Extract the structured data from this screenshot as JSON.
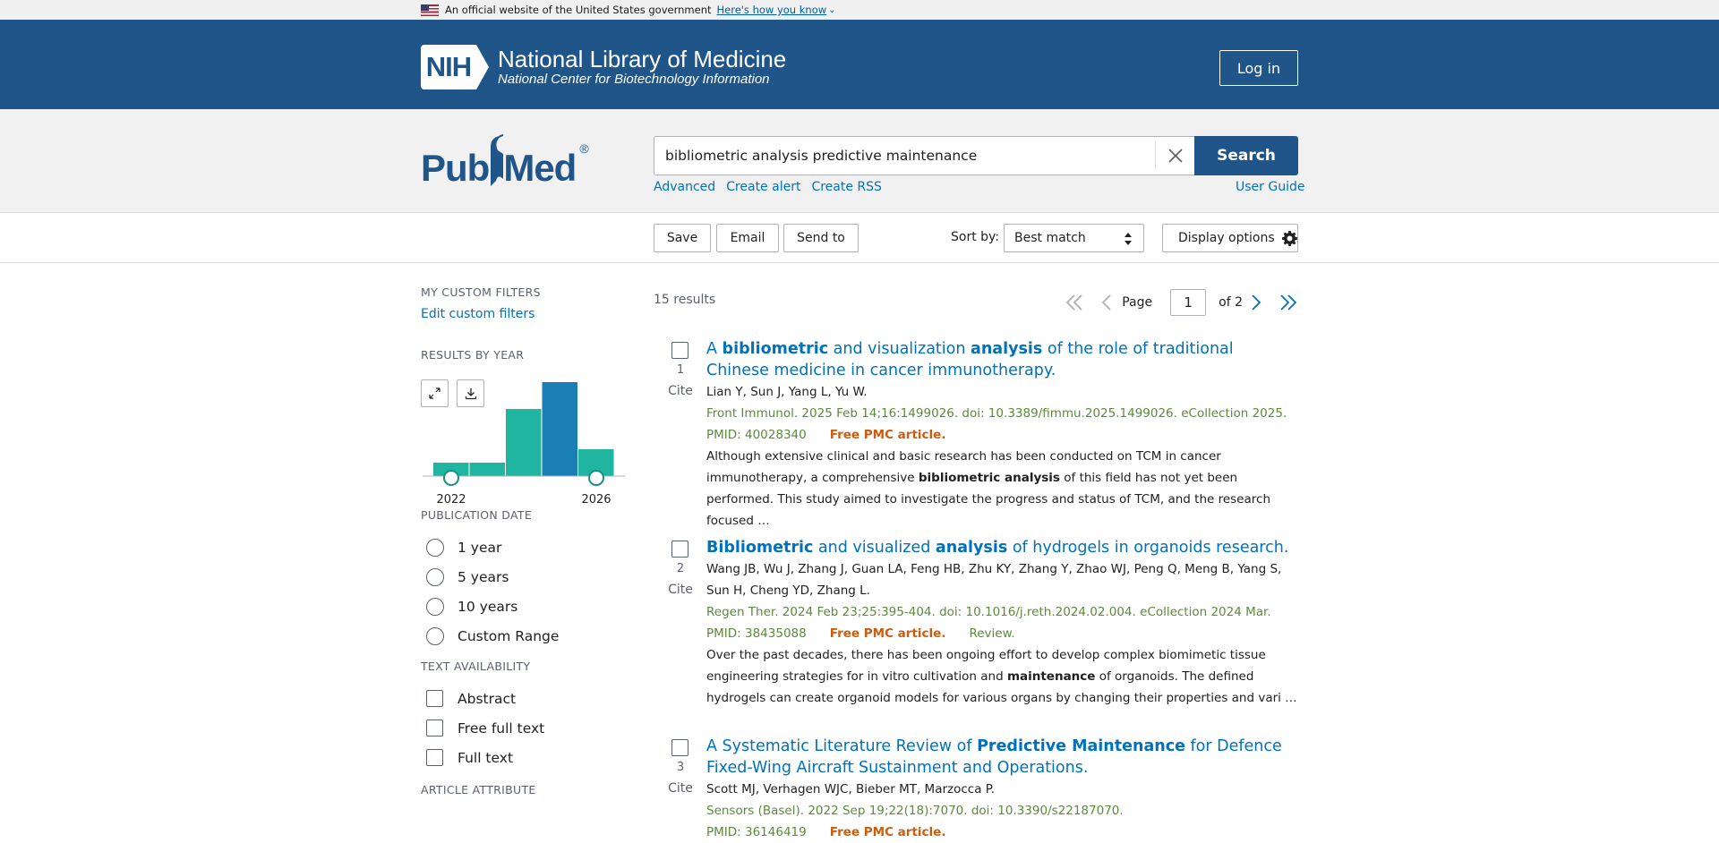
{
  "gov_banner": {
    "text": "An official website of the United States government",
    "link": "Here's how you know"
  },
  "nih": {
    "badge": "NIH",
    "title": "National Library of Medicine",
    "subtitle": "National Center for Biotechnology Information",
    "login": "Log in"
  },
  "pubmed": {
    "logo_pub": "Pub",
    "logo_med": "Med",
    "logo_reg": "®",
    "search_value": "bibliometric analysis predictive maintenance",
    "search_button": "Search",
    "links": [
      "Advanced",
      "Create alert",
      "Create RSS"
    ],
    "user_guide": "User Guide"
  },
  "toolbar": {
    "save": "Save",
    "email": "Email",
    "send_to": "Send to",
    "sort_label": "Sort by:",
    "sort_value": "Best match",
    "display_options": "Display options"
  },
  "sidebar": {
    "custom_filters_heading": "MY CUSTOM FILTERS",
    "edit_custom_filters": "Edit custom filters",
    "results_by_year_heading": "RESULTS BY YEAR",
    "year_start": "2022",
    "year_end": "2026",
    "publication_date_heading": "PUBLICATION DATE",
    "publication_date_options": [
      "1 year",
      "5 years",
      "10 years",
      "Custom Range"
    ],
    "text_availability_heading": "TEXT AVAILABILITY",
    "text_availability_options": [
      "Abstract",
      "Free full text",
      "Full text"
    ],
    "article_attribute_heading": "ARTICLE ATTRIBUTE"
  },
  "chart_data": {
    "type": "bar",
    "categories": [
      "2022",
      "2023",
      "2024",
      "2025",
      "2026"
    ],
    "values": [
      1,
      1,
      5,
      7,
      2
    ],
    "xlabel": "",
    "ylabel": ""
  },
  "colors": {
    "header_blue": "#20558a",
    "link_blue": "#0071bc",
    "bar_teal": "#20b5a0",
    "bar_highlight": "#1a7fb5",
    "free_pmc": "#cd5d0e",
    "citation_green": "#5b8a3c"
  },
  "results_meta": {
    "count": "15 results",
    "page_label": "Page",
    "page_value": "1",
    "of_pages": "of 2"
  },
  "results": [
    {
      "num": "1",
      "cite": "Cite",
      "title_parts": [
        {
          "t": "A ",
          "b": false
        },
        {
          "t": "bibliometric",
          "b": true
        },
        {
          "t": " and visualization ",
          "b": false
        },
        {
          "t": "analysis",
          "b": true
        },
        {
          "t": " of the role of traditional Chinese medicine in cancer immunotherapy.",
          "b": false
        }
      ],
      "authors": "Lian Y, Sun J, Yang L, Yu W.",
      "citation": "Front Immunol. 2025 Feb 14;16:1499026. doi: 10.3389/fimmu.2025.1499026. eCollection 2025.",
      "pmid": "PMID: 40028340",
      "free": "Free PMC article.",
      "review": "",
      "snippet_parts": [
        {
          "t": "Although extensive clinical and basic research has been conducted on TCM in cancer immunotherapy, a comprehensive ",
          "b": false
        },
        {
          "t": "bibliometric analysis",
          "b": true
        },
        {
          "t": " of this field has not yet been performed. This study aimed to investigate the progress and status of TCM, and the research focused …",
          "b": false
        }
      ]
    },
    {
      "num": "2",
      "cite": "Cite",
      "title_parts": [
        {
          "t": "Bibliometric",
          "b": true
        },
        {
          "t": " and visualized ",
          "b": false
        },
        {
          "t": "analysis",
          "b": true
        },
        {
          "t": " of hydrogels in organoids research.",
          "b": false
        }
      ],
      "authors": "Wang JB, Wu J, Zhang J, Guan LA, Feng HB, Zhu KY, Zhang Y, Zhao WJ, Peng Q, Meng B, Yang S, Sun H, Cheng YD, Zhang L.",
      "citation": "Regen Ther. 2024 Feb 23;25:395-404. doi: 10.1016/j.reth.2024.02.004. eCollection 2024 Mar.",
      "pmid": "PMID: 38435088",
      "free": "Free PMC article.",
      "review": "Review.",
      "snippet_parts": [
        {
          "t": "Over the past decades, there has been ongoing effort to develop complex biomimetic tissue engineering strategies for in vitro cultivation and ",
          "b": false
        },
        {
          "t": "maintenance",
          "b": true
        },
        {
          "t": " of organoids. The defined hydrogels can create organoid models for various organs by changing their properties and vari …",
          "b": false
        }
      ]
    },
    {
      "num": "3",
      "cite": "Cite",
      "title_parts": [
        {
          "t": "A Systematic Literature Review of ",
          "b": false
        },
        {
          "t": "Predictive Maintenance",
          "b": true
        },
        {
          "t": " for Defence Fixed-Wing Aircraft Sustainment and Operations.",
          "b": false
        }
      ],
      "authors": "Scott MJ, Verhagen WJC, Bieber MT, Marzocca P.",
      "citation": "Sensors (Basel). 2022 Sep 19;22(18):7070. doi: 10.3390/s22187070.",
      "pmid": "PMID: 36146419",
      "free": "Free PMC article.",
      "review": "",
      "snippet_parts": []
    }
  ]
}
